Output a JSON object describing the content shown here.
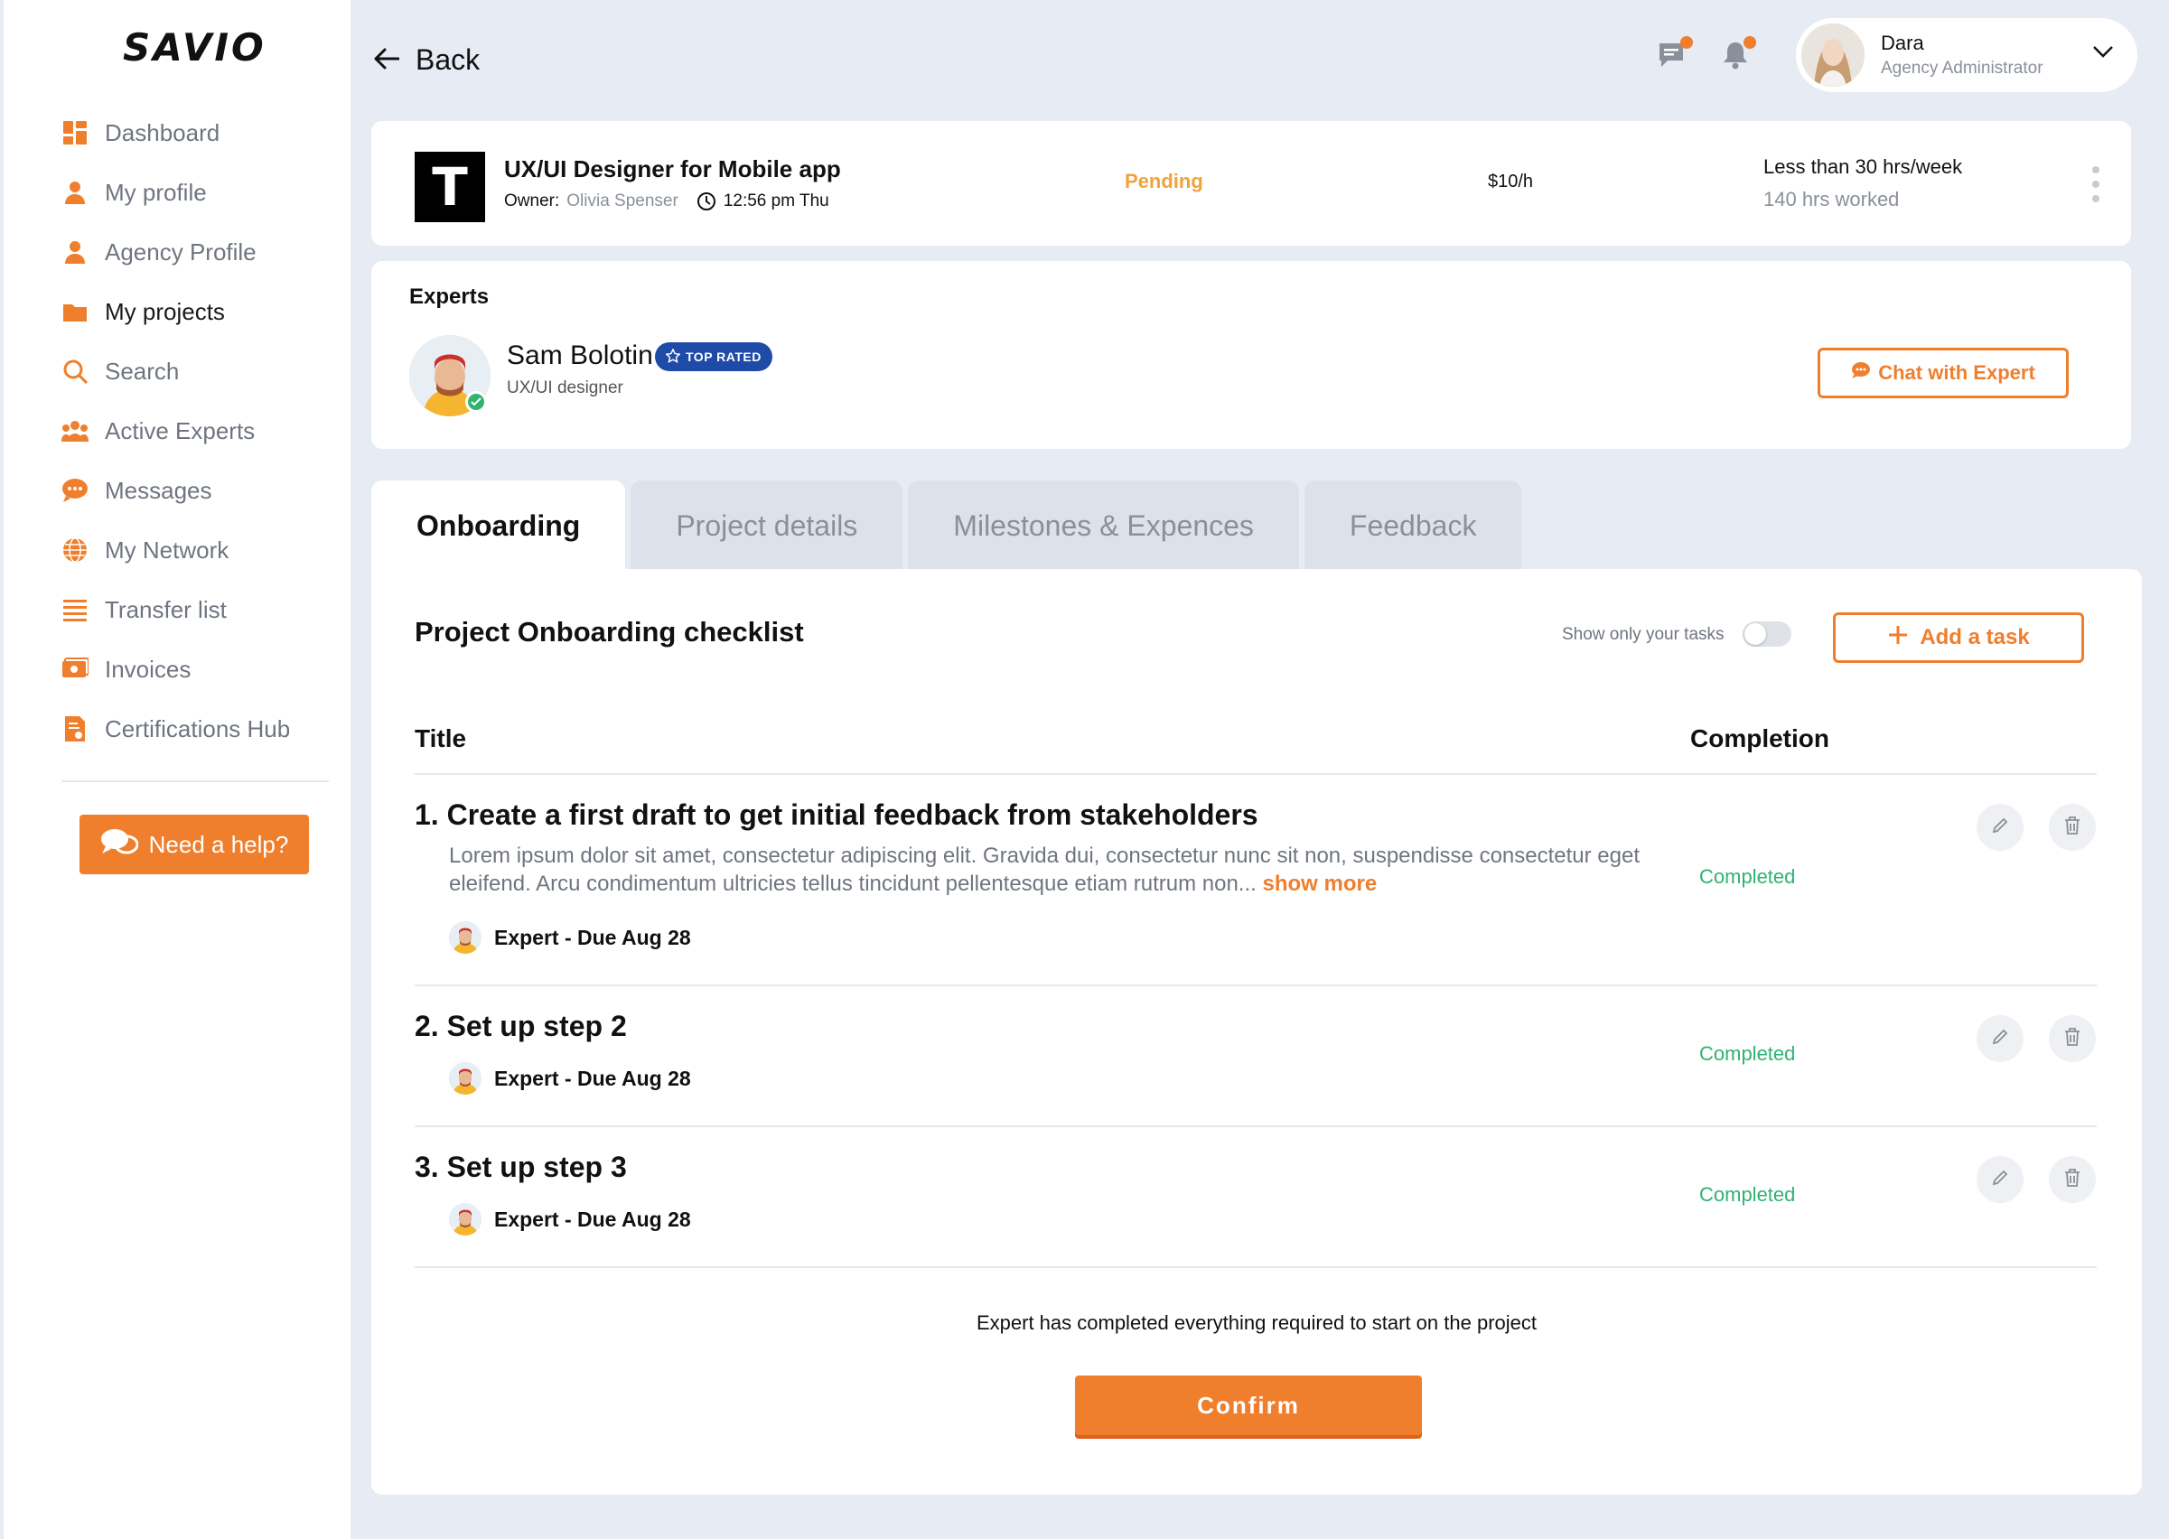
{
  "brand": {
    "logo_text": "SAVIO",
    "accent": "#ef7f2d"
  },
  "sidebar": {
    "items": [
      {
        "label": "Dashboard",
        "icon": "dashboard-icon"
      },
      {
        "label": "My profile",
        "icon": "person-icon"
      },
      {
        "label": "Agency Profile",
        "icon": "person-icon"
      },
      {
        "label": "My projects",
        "icon": "folder-icon",
        "active": true
      },
      {
        "label": "Search",
        "icon": "search-icon"
      },
      {
        "label": "Active Experts",
        "icon": "group-icon"
      },
      {
        "label": "Messages",
        "icon": "chat-icon"
      },
      {
        "label": "My Network",
        "icon": "globe-icon"
      },
      {
        "label": "Transfer list",
        "icon": "list-icon"
      },
      {
        "label": "Invoices",
        "icon": "invoice-icon"
      },
      {
        "label": "Certifications Hub",
        "icon": "certificate-icon"
      }
    ],
    "help_label": "Need a help?"
  },
  "header": {
    "back_label": "Back",
    "user": {
      "name": "Dara",
      "role": "Agency Administrator"
    }
  },
  "job": {
    "logo_letter": "T",
    "title": "UX/UI Designer for Mobile app",
    "owner_label": "Owner:",
    "owner_name": "Olivia Spenser",
    "time": "12:56 pm Thu",
    "status": "Pending",
    "rate": "$10/h",
    "hours_per_week": "Less than 30 hrs/week",
    "hours_worked": "140 hrs worked"
  },
  "experts": {
    "heading": "Experts",
    "name": "Sam Bolotin",
    "badge": "TOP RATED",
    "role": "UX/UI designer",
    "chat_label": "Chat with Expert"
  },
  "tabs": [
    {
      "label": "Onboarding",
      "active": true
    },
    {
      "label": "Project details"
    },
    {
      "label": "Milestones & Expences"
    },
    {
      "label": "Feedback"
    }
  ],
  "checklist": {
    "title": "Project Onboarding checklist",
    "toggle_label": "Show only your tasks",
    "add_task_label": "Add a task",
    "col_title": "Title",
    "col_completion": "Completion",
    "tasks": [
      {
        "title": "1. Create a first draft to get initial feedback from stakeholders",
        "desc": "Lorem ipsum dolor sit amet, consectetur adipiscing elit. Gravida dui, consectetur nunc sit non, suspendisse consectetur eget eleifend. Arcu condimentum ultricies tellus tincidunt pellentesque etiam rutrum non...",
        "show_more": "show more",
        "assignee": "Expert - Due Aug 28",
        "status": "Completed"
      },
      {
        "title": "2. Set up step 2",
        "assignee": "Expert - Due Aug 28",
        "status": "Completed"
      },
      {
        "title": "3. Set up step 3",
        "assignee": "Expert - Due Aug 28",
        "status": "Completed"
      }
    ],
    "footer_note": "Expert has completed everything required to start on the project",
    "confirm_label": "Confirm"
  }
}
